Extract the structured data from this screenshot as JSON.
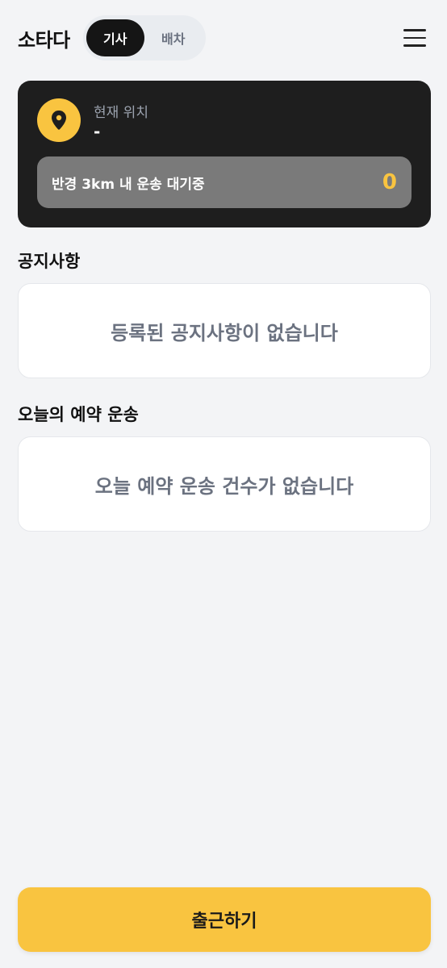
{
  "header": {
    "app_title": "소타다",
    "roles": [
      {
        "label": "기사",
        "active": true
      },
      {
        "label": "배차",
        "active": false
      }
    ],
    "menu_icon": "hamburger-menu-icon"
  },
  "location": {
    "icon": "map-pin-icon",
    "label": "현재 위치",
    "value": "-",
    "waiting_label": "반경 3km 내 운송 대기중",
    "waiting_count": "0"
  },
  "notices": {
    "title": "공지사항",
    "empty_text": "등록된 공지사항이 없습니다"
  },
  "reservations": {
    "title": "오늘의 예약 운송",
    "empty_text": "오늘 예약 운송 건수가 없습니다"
  },
  "cta": {
    "label": "출근하기"
  },
  "colors": {
    "accent": "#F9C440",
    "dark_card": "#1E1E1E",
    "background": "#F3F4F6"
  }
}
